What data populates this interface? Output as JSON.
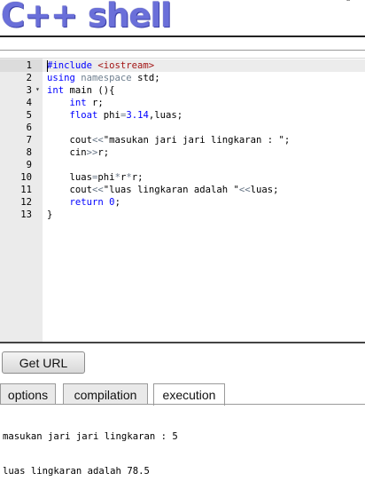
{
  "header": {
    "logo_text": "C++ shell",
    "corner_glyph": "ᵇ"
  },
  "editor": {
    "lines": [
      {
        "num": "1",
        "fold": "",
        "tokens": [
          {
            "t": "#include ",
            "c": "kw"
          },
          {
            "t": "<iostream>",
            "c": "str"
          }
        ]
      },
      {
        "num": "2",
        "fold": "",
        "tokens": [
          {
            "t": "using ",
            "c": "kw"
          },
          {
            "t": "namespace ",
            "c": "ns"
          },
          {
            "t": "std;",
            "c": ""
          }
        ]
      },
      {
        "num": "3",
        "fold": "▾",
        "tokens": [
          {
            "t": "int ",
            "c": "kw"
          },
          {
            "t": "main (){",
            "c": ""
          }
        ]
      },
      {
        "num": "4",
        "fold": "",
        "tokens": [
          {
            "t": "    ",
            "c": ""
          },
          {
            "t": "int ",
            "c": "kw"
          },
          {
            "t": "r;",
            "c": ""
          }
        ]
      },
      {
        "num": "5",
        "fold": "",
        "tokens": [
          {
            "t": "    ",
            "c": ""
          },
          {
            "t": "float ",
            "c": "kw"
          },
          {
            "t": "phi",
            "c": ""
          },
          {
            "t": "=",
            "c": "op"
          },
          {
            "t": "3.14",
            "c": "num"
          },
          {
            "t": ",luas;",
            "c": ""
          }
        ]
      },
      {
        "num": "6",
        "fold": "",
        "tokens": []
      },
      {
        "num": "7",
        "fold": "",
        "tokens": [
          {
            "t": "    cout",
            "c": ""
          },
          {
            "t": "<<",
            "c": "op"
          },
          {
            "t": "\"masukan jari jari lingkaran : \"",
            "c": ""
          },
          {
            "t": ";",
            "c": ""
          }
        ]
      },
      {
        "num": "8",
        "fold": "",
        "tokens": [
          {
            "t": "    cin",
            "c": ""
          },
          {
            "t": ">>",
            "c": "op"
          },
          {
            "t": "r;",
            "c": ""
          }
        ]
      },
      {
        "num": "9",
        "fold": "",
        "tokens": []
      },
      {
        "num": "10",
        "fold": "",
        "tokens": [
          {
            "t": "    luas",
            "c": ""
          },
          {
            "t": "=",
            "c": "op"
          },
          {
            "t": "phi",
            "c": ""
          },
          {
            "t": "*",
            "c": "op"
          },
          {
            "t": "r",
            "c": ""
          },
          {
            "t": "*",
            "c": "op"
          },
          {
            "t": "r;",
            "c": ""
          }
        ]
      },
      {
        "num": "11",
        "fold": "",
        "tokens": [
          {
            "t": "    cout",
            "c": ""
          },
          {
            "t": "<<",
            "c": "op"
          },
          {
            "t": "\"luas lingkaran adalah \"",
            "c": ""
          },
          {
            "t": "<<",
            "c": "op"
          },
          {
            "t": "luas;",
            "c": ""
          }
        ]
      },
      {
        "num": "12",
        "fold": "",
        "tokens": [
          {
            "t": "    ",
            "c": ""
          },
          {
            "t": "return ",
            "c": "kw"
          },
          {
            "t": "0",
            "c": "num"
          },
          {
            "t": ";",
            "c": ""
          }
        ]
      },
      {
        "num": "13",
        "fold": "",
        "tokens": [
          {
            "t": "}",
            "c": ""
          }
        ]
      }
    ]
  },
  "actions": {
    "get_url_label": "Get URL"
  },
  "tabs": [
    {
      "label": "options",
      "active": false
    },
    {
      "label": "compilation",
      "active": false
    },
    {
      "label": "execution",
      "active": true
    }
  ],
  "output": {
    "lines": [
      "masukan jari jari lingkaran : 5",
      "luas lingkaran adalah 78.5"
    ]
  },
  "colors": {
    "logo": "#6a6fd9",
    "keyword": "#0000ff",
    "string": "#a31515",
    "gutter": "#ebebeb"
  }
}
